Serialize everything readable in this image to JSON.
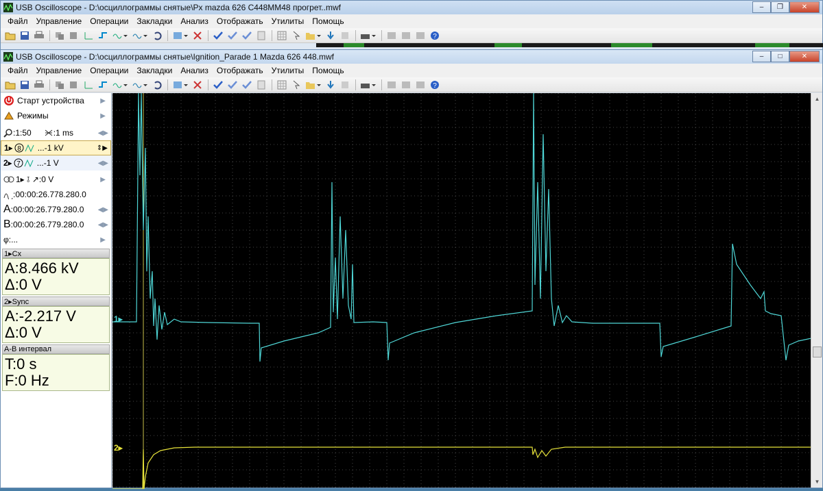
{
  "back_window": {
    "title": "USB Oscilloscope - D:\\осциллограммы снятые\\Px mazda 626 C448MM48 прогрет..mwf",
    "menu": [
      "Файл",
      "Управление",
      "Операции",
      "Закладки",
      "Анализ",
      "Отображать",
      "Утилиты",
      "Помощь"
    ]
  },
  "front_window": {
    "title": "USB Oscilloscope - D:\\осциллограммы снятые\\Ignition_Parade 1 Mazda 626 448.mwf",
    "menu": [
      "Файл",
      "Управление",
      "Операции",
      "Закладки",
      "Анализ",
      "Отображать",
      "Утилиты",
      "Помощь"
    ],
    "window_controls": {
      "minimize": "–",
      "maximize": "□",
      "close": "✕"
    }
  },
  "left_panel": {
    "start_device": "Старт устройства",
    "modes": "Режимы",
    "zoom": ":1:50",
    "timebase": ":1 ms",
    "ch1_label": "1▸",
    "ch1_scale": "...-1 kV",
    "ch2_label": "2▸",
    "ch2_scale": "...-1 V",
    "trigger": "1▸  ⫱ ↗:0 V",
    "trigger_time": ":00:00:26.778.280.0",
    "cursor_a": ":00:00:26.779.280.0",
    "cursor_b": ":00:00:26.779.280.0",
    "phi": "φ:...",
    "ch1_header": "1▸Cx",
    "ch1_a": "A:8.466 kV",
    "ch1_delta": "Δ:0 V",
    "ch2_header": "2▸Sync",
    "ch2_a": "A:-2.217 V",
    "ch2_delta": "Δ:0 V",
    "ab_header": "A-B интервал",
    "ab_t": "T:0 s",
    "ab_f": "F:0 Hz"
  },
  "plot": {
    "ch1_marker": "1▸",
    "ch2_marker": "2▸",
    "colors": {
      "ch1": "#4fd6d6",
      "ch2": "#e6e23a",
      "grid": "#5a5a5a",
      "background": "#000000"
    }
  }
}
